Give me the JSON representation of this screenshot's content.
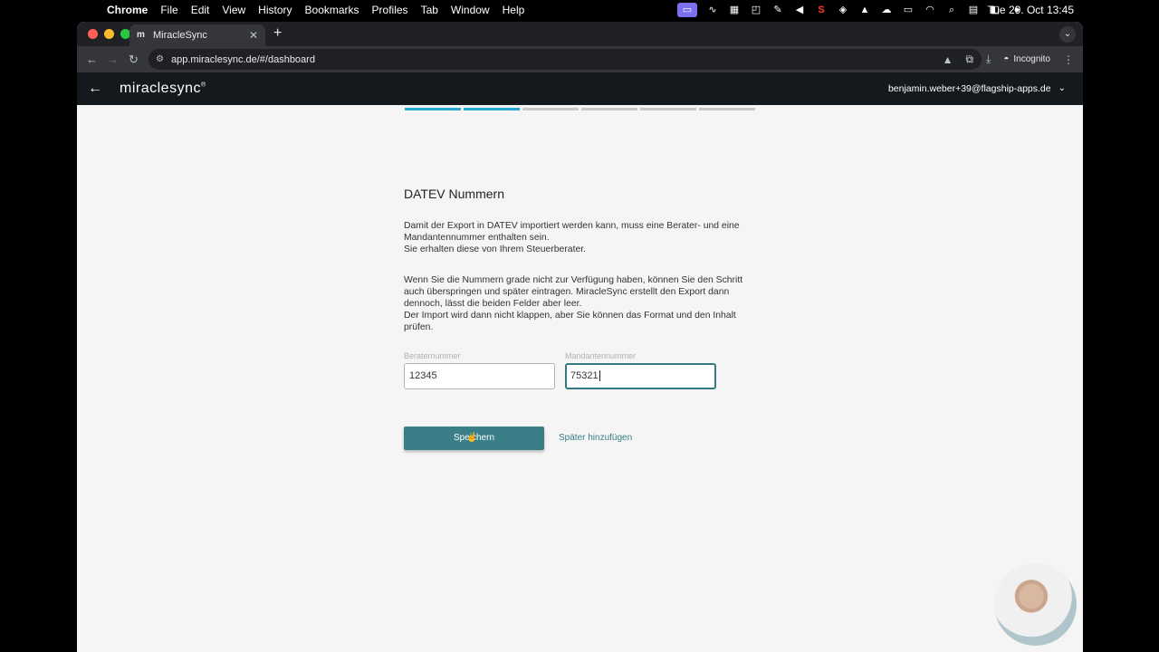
{
  "menubar": {
    "app_name": "Chrome",
    "items": [
      "File",
      "Edit",
      "View",
      "History",
      "Bookmarks",
      "Profiles",
      "Tab",
      "Window",
      "Help"
    ],
    "clock": "Tue 29. Oct  13:45"
  },
  "browser": {
    "tab_title": "MiracleSync",
    "tab_favicon": "m",
    "url": "app.miraclesync.de/#/dashboard",
    "incognito_label": "Incognito"
  },
  "app": {
    "logo": "miraclesync",
    "logo_mark": "®",
    "user_email": "benjamin.weber+39@flagship-apps.de",
    "progress": {
      "total_steps": 6,
      "completed_steps": 2
    }
  },
  "form": {
    "title": "DATEV Nummern",
    "intro_line1": "Damit der Export in DATEV importiert werden kann, muss eine Berater- und eine Mandantennummer enthalten sein.",
    "intro_line2": "Sie erhalten diese von Ihrem Steuerberater.",
    "info_line1": "Wenn Sie die Nummern grade nicht zur Verfügung haben, können Sie den Schritt auch überspringen und später eintragen.  MiracleSync erstellt den Export dann dennoch, lässt die beiden Felder aber leer.",
    "info_line2": "Der Import wird dann nicht klappen, aber Sie können das Format und den Inhalt prüfen.",
    "berater_label": "Beraternummer",
    "berater_value": "12345",
    "mandant_label": "Mandantennummer",
    "mandant_value": "75321",
    "save_label": "Speichern",
    "later_label": "Später hinzufügen"
  },
  "colors": {
    "accent": "#3a7f87",
    "progress_done": "#29a8d8",
    "app_header": "#14191d"
  }
}
